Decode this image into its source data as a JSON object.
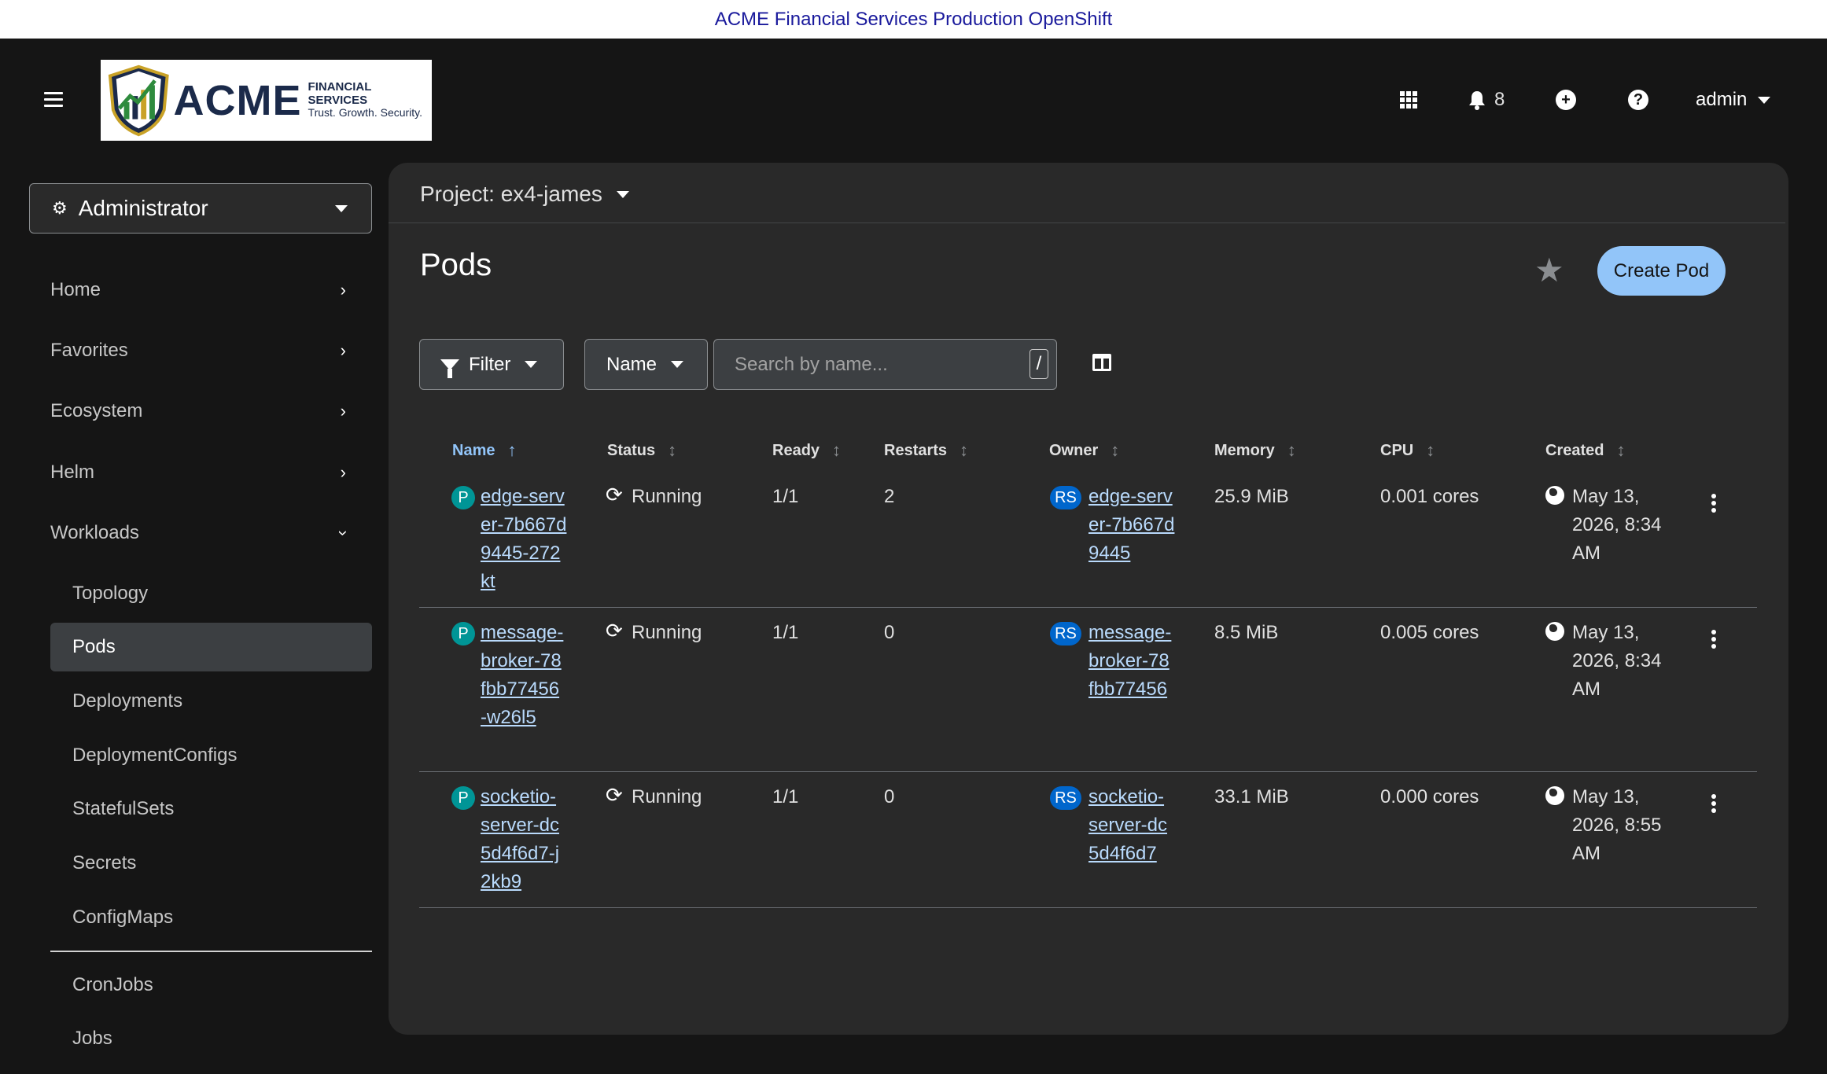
{
  "banner": {
    "text": "ACME Financial Services Production OpenShift"
  },
  "masthead": {
    "logo": {
      "brand": "ACME",
      "line1": "FINANCIAL SERVICES",
      "line2": "Trust. Growth. Security."
    },
    "notifications_count": "8",
    "user": "admin"
  },
  "sidebar": {
    "perspective": "Administrator",
    "sections": [
      {
        "label": "Home"
      },
      {
        "label": "Favorites"
      },
      {
        "label": "Ecosystem"
      },
      {
        "label": "Helm"
      },
      {
        "label": "Workloads"
      }
    ],
    "workloads": [
      {
        "label": "Topology"
      },
      {
        "label": "Pods"
      },
      {
        "label": "Deployments"
      },
      {
        "label": "DeploymentConfigs"
      },
      {
        "label": "StatefulSets"
      },
      {
        "label": "Secrets"
      },
      {
        "label": "ConfigMaps"
      },
      {
        "label": "CronJobs"
      },
      {
        "label": "Jobs"
      }
    ]
  },
  "main": {
    "project": "Project: ex4-james",
    "title": "Pods",
    "create_label": "Create Pod",
    "filter_label": "Filter",
    "name_select": "Name",
    "search_placeholder": "Search by name...",
    "search_shortcut": "/",
    "columns": [
      "Name",
      "Status",
      "Ready",
      "Restarts",
      "Owner",
      "Memory",
      "CPU",
      "Created"
    ],
    "rows": [
      {
        "kind_badge": "P",
        "name": "edge-server-7b667d9445-272kt",
        "status": "Running",
        "ready": "1/1",
        "restarts": "2",
        "owner_badge": "RS",
        "owner": "edge-server-7b667d9445",
        "memory": "25.9 MiB",
        "cpu": "0.001 cores",
        "created": "May 13, 2026, 8:34 AM"
      },
      {
        "kind_badge": "P",
        "name": "message-broker-78fbb77456-w26l5",
        "status": "Running",
        "ready": "1/1",
        "restarts": "0",
        "owner_badge": "RS",
        "owner": "message-broker-78fbb77456",
        "memory": "8.5 MiB",
        "cpu": "0.005 cores",
        "created": "May 13, 2026, 8:34 AM"
      },
      {
        "kind_badge": "P",
        "name": "socketio-server-dc5d4f6d7-j2kb9",
        "status": "Running",
        "ready": "1/1",
        "restarts": "0",
        "owner_badge": "RS",
        "owner": "socketio-server-dc5d4f6d7",
        "memory": "33.1 MiB",
        "cpu": "0.000 cores",
        "created": "May 13, 2026, 8:55 AM"
      }
    ]
  }
}
